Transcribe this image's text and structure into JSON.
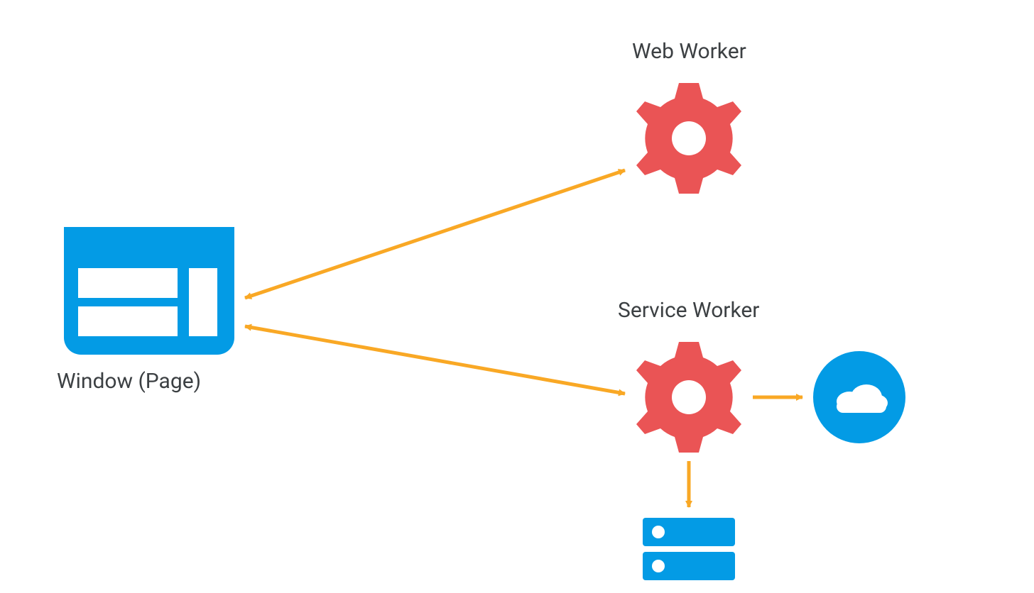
{
  "labels": {
    "window": "Window (Page)",
    "web_worker": "Web Worker",
    "service_worker": "Service Worker"
  },
  "colors": {
    "blue": "#039be5",
    "red": "#ea5455",
    "orange": "#f9a825",
    "text": "#3c4043",
    "white": "#ffffff"
  },
  "nodes": [
    {
      "id": "window",
      "type": "browser-window",
      "label_key": "window"
    },
    {
      "id": "web_worker",
      "type": "gear",
      "label_key": "web_worker"
    },
    {
      "id": "service_worker",
      "type": "gear",
      "label_key": "service_worker"
    },
    {
      "id": "cloud",
      "type": "cloud"
    },
    {
      "id": "storage",
      "type": "storage"
    }
  ],
  "edges": [
    {
      "from": "window",
      "to": "web_worker",
      "bidirectional": true
    },
    {
      "from": "window",
      "to": "service_worker",
      "bidirectional": true
    },
    {
      "from": "service_worker",
      "to": "cloud",
      "bidirectional": false
    },
    {
      "from": "service_worker",
      "to": "storage",
      "bidirectional": false
    }
  ]
}
